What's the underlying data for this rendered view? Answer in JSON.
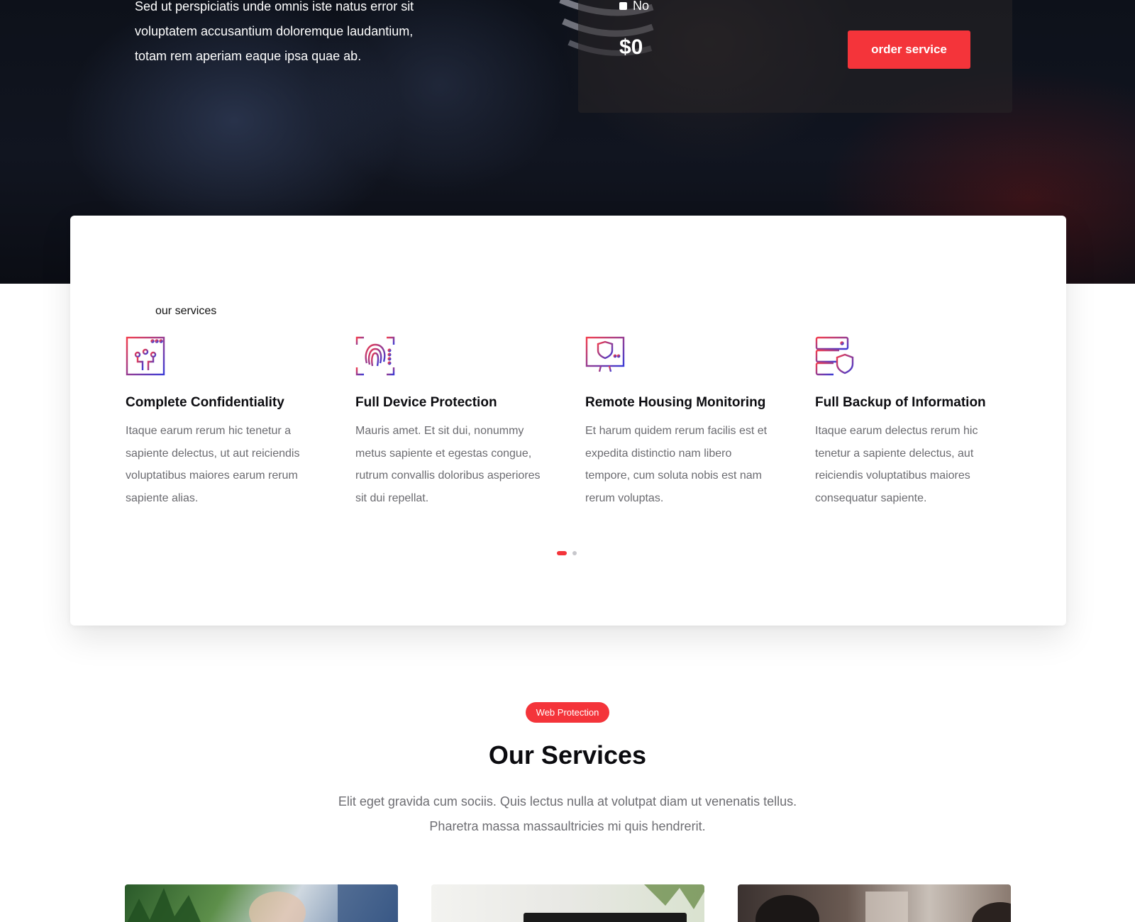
{
  "hero": {
    "text_lines": [
      "Sed ut perspiciatis unde omnis iste natus error sit",
      "voluptatem accusantium doloremque laudantium,",
      "totam rem aperiam eaque ipsa quae ab."
    ],
    "no_option_label": "No",
    "price": "$0",
    "order_button_label": "order service"
  },
  "services_card": {
    "eyebrow": "our services",
    "items": [
      {
        "icon": "circuit-window-icon",
        "title": "Complete Confidentiality",
        "description": "Itaque earum rerum hic tenetur a sapiente delectus, ut aut reiciendis voluptatibus maiores earum rerum sapiente alias."
      },
      {
        "icon": "fingerprint-icon",
        "title": "Full Device Protection",
        "description": "Mauris amet. Et sit dui, nonummy metus sapiente et egestas congue, rutrum convallis doloribus asperiores sit dui repellat."
      },
      {
        "icon": "monitor-shield-icon",
        "title": "Remote Housing Monitoring",
        "description": "Et harum quidem rerum facilis est et expedita distinctio nam libero tempore, cum soluta nobis est nam rerum voluptas."
      },
      {
        "icon": "server-shield-icon",
        "title": "Full Backup of Information",
        "description": "Itaque earum delectus rerum hic tenetur a sapiente delectus, aut reiciendis voluptatibus maiores consequatur sapiente."
      }
    ],
    "carousel_pages": 2,
    "carousel_active_page": 1
  },
  "section": {
    "pill": "Web Protection",
    "title": "Our Services",
    "subtitle_lines": [
      "Elit eget gravida cum sociis. Quis lectus nulla at volutpat diam ut venenatis tellus.",
      "Pharetra massa massaultricies mi quis hendrerit."
    ]
  },
  "colors": {
    "accent": "#f4343a",
    "icon_gradient_start": "#f23c4c",
    "icon_gradient_end": "#3b3bd6"
  }
}
